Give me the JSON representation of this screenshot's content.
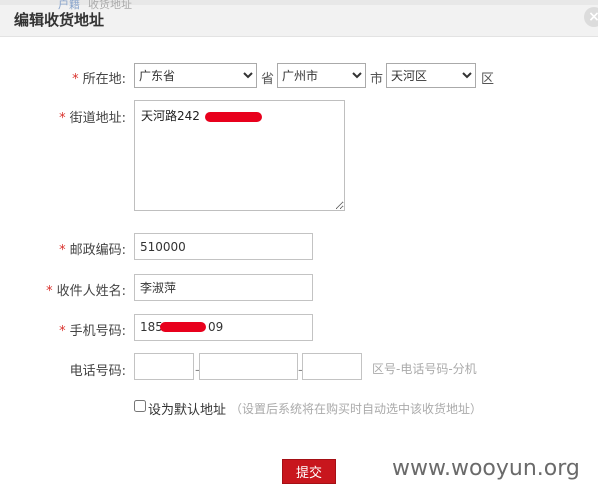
{
  "background_tabs": [
    "户籍",
    "收货地址"
  ],
  "dialog": {
    "title": "编辑收货地址",
    "close_icon": "×"
  },
  "form": {
    "required_mark": "*",
    "region": {
      "label": "所在地:",
      "province": "广东省",
      "province_unit": "省",
      "city": "广州市",
      "city_unit": "市",
      "district": "天河区",
      "district_unit": "区"
    },
    "street": {
      "label": "街道地址:",
      "value": "天河路242"
    },
    "postcode": {
      "label": "邮政编码:",
      "value": "510000"
    },
    "recipient": {
      "label": "收件人姓名:",
      "value": "李淑萍"
    },
    "mobile": {
      "label": "手机号码:",
      "value_start": "185",
      "value_end": "09"
    },
    "phone": {
      "label": "电话号码:",
      "separator": "-",
      "hint": "区号-电话号码-分机"
    },
    "default": {
      "label": "设为默认地址",
      "note": "（设置后系统将在购买时自动选中该收货地址）"
    },
    "submit_label": "提交"
  },
  "watermark": "www.wooyun.org",
  "colors": {
    "required": "#d9302b",
    "submit": "#c8161d",
    "redaction": "#e8001c"
  }
}
